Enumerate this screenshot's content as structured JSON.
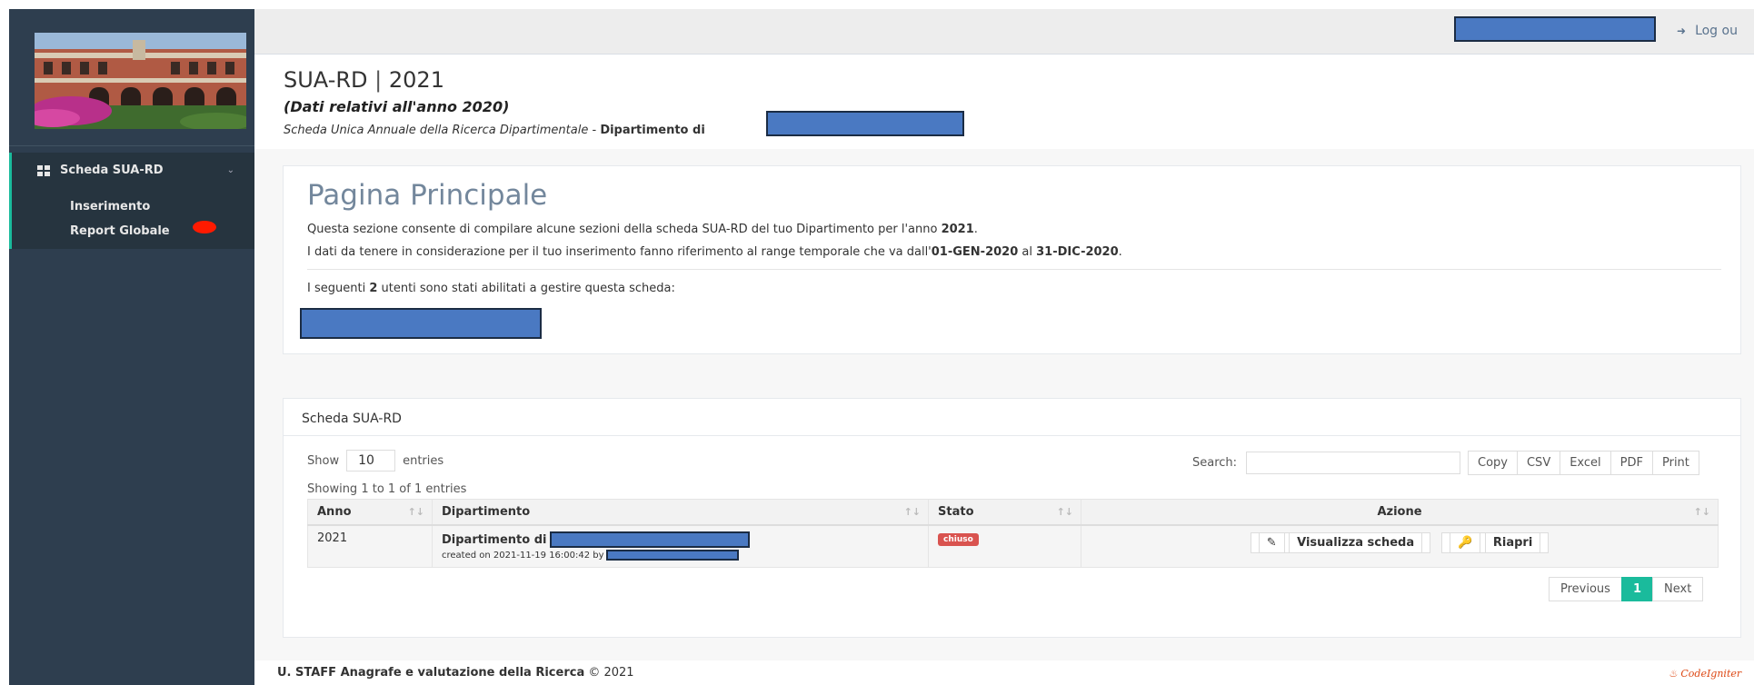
{
  "sidebar": {
    "menu_title": "Scheda SUA-RD",
    "items": [
      {
        "label": "Inserimento"
      },
      {
        "label": "Report Globale"
      }
    ]
  },
  "topbar": {
    "logout_label": "Log ou"
  },
  "header": {
    "title": "SUA-RD",
    "separator": "|",
    "year": "2021",
    "subtitle": "(Dati relativi all'anno 2020)",
    "desc_italic": "Scheda Unica Annuale della Ricerca Dipartimentale",
    "desc_dash": " - ",
    "desc_bold": "Dipartimento di"
  },
  "main_panel": {
    "title": "Pagina Principale",
    "line1_pre": "Questa sezione consente di compilare alcune sezioni della scheda SUA-RD del tuo Dipartimento per l'anno ",
    "line1_bold": "2021",
    "line1_post": ".",
    "line2_pre": "I dati da tenere in considerazione per il tuo inserimento fanno riferimento al range temporale che va dall'",
    "line2_from": "01-GEN-2020",
    "line2_mid": " al ",
    "line2_to": "31-DIC-2020",
    "line2_post": ".",
    "line3_pre": "I seguenti ",
    "line3_count": "2",
    "line3_post": " utenti sono stati abilitati a gestire questa scheda:"
  },
  "table_panel": {
    "title": "Scheda SUA-RD",
    "show_label": "Show",
    "entries_value": "10",
    "entries_label": "entries",
    "search_label": "Search:",
    "export_buttons": [
      "Copy",
      "CSV",
      "Excel",
      "PDF",
      "Print"
    ],
    "showing_text": "Showing 1 to 1 of 1 entries",
    "columns": [
      "Anno",
      "Dipartimento",
      "Stato",
      "Azione"
    ],
    "sort_icon": "↑↓",
    "rows": [
      {
        "anno": "2021",
        "dipartimento": "Dipartimento di",
        "created": "created on 2021-11-19 16:00:42 by",
        "stato": "chiuso",
        "view_label": "Visualizza scheda",
        "reopen_label": "Riapri"
      }
    ],
    "pagination": {
      "previous": "Previous",
      "page": "1",
      "next": "Next"
    }
  },
  "footer": {
    "org": "U. STAFF Anagrafe e valutazione della Ricerca",
    "copyright": " © 2021",
    "brand": "CodeIgniter"
  },
  "colors": {
    "sidebar": "#2e3e4f",
    "accent": "#1abb9c",
    "redaction": "#4a79c2",
    "status_closed": "#d9534f"
  }
}
